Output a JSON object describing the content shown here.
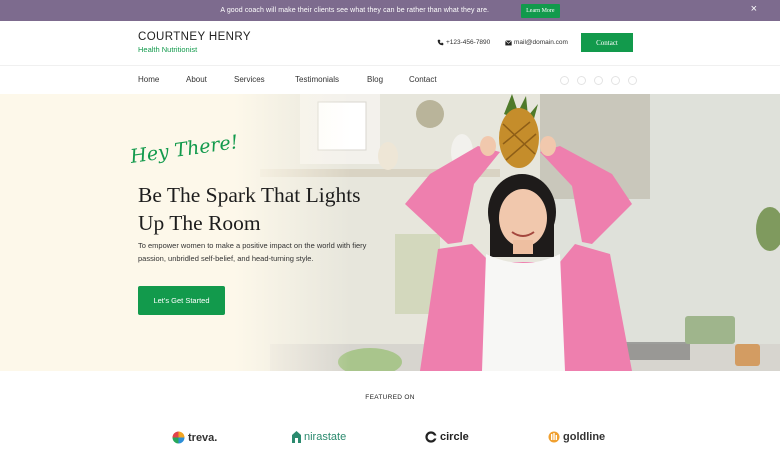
{
  "announcement": {
    "message": "A good coach will make their clients see what they can be rather than what they are.",
    "learn_more": "Learn More",
    "close": "×"
  },
  "header": {
    "brand_name": "COURTNEY HENRY",
    "brand_subtitle": "Health Nutritionist",
    "phone": "+123-456-7890",
    "email": "mail@domain.com",
    "contact_label": "Contact"
  },
  "nav": {
    "items": [
      "Home",
      "About",
      "Services",
      "Testimonials",
      "Blog",
      "Contact"
    ]
  },
  "hero": {
    "greeting": "Hey There!",
    "headline_line1": "Be The Spark That Lights",
    "headline_line2": "Up The Room",
    "subtext": "To empower women to make a positive impact on the world with fiery passion, unbridled self-belief, and head-turning style.",
    "cta_label": "Let's Get Started"
  },
  "featured": {
    "heading": "FEATURED ON",
    "logos": [
      "treva.",
      "nirastate",
      "circle",
      "goldline"
    ]
  },
  "colors": {
    "accent_green": "#129a4c",
    "announcement_bg": "#7d6b8e",
    "hero_bg": "#fdf8ea",
    "shirt_pink": "#ee7fae"
  }
}
